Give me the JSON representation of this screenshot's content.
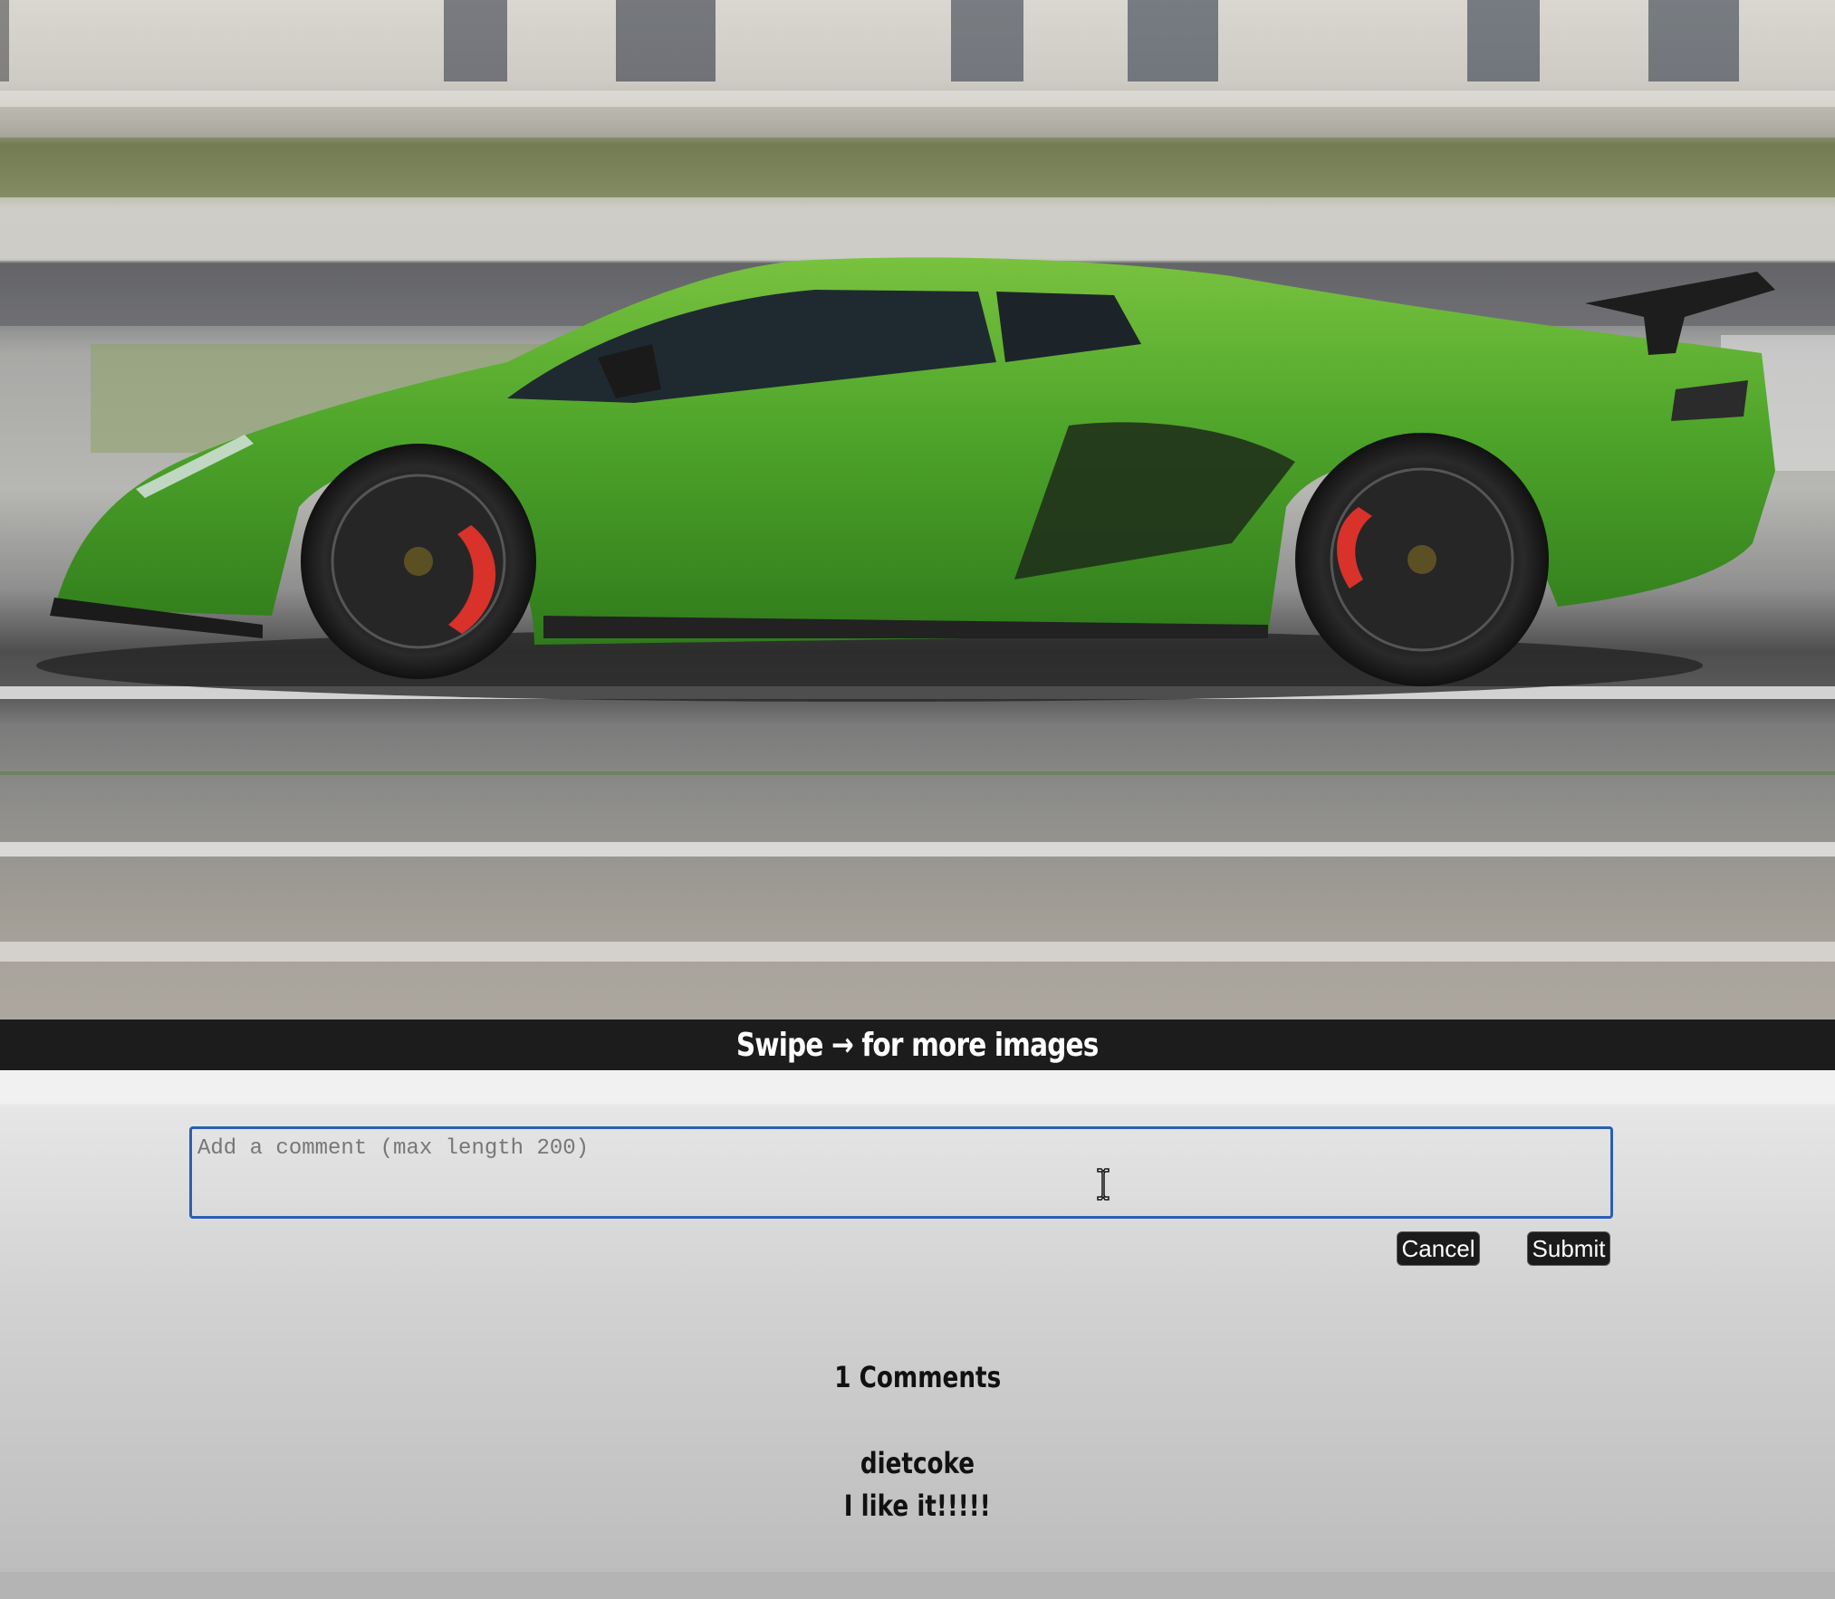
{
  "photo": {
    "subject": "green-sports-car-photo",
    "car_color": "#4ea52a",
    "caliper_color": "#d8322b"
  },
  "swipe_hint": "Swipe → for more images",
  "comment_form": {
    "placeholder": "Add a comment (max length 200)",
    "value": "",
    "cancel_label": "Cancel",
    "submit_label": "Submit",
    "border_color": "#2a5fb4"
  },
  "comments": {
    "count_label": "1 Comments",
    "items": [
      {
        "author": "dietcoke",
        "text": "I like it!!!!!"
      }
    ]
  }
}
